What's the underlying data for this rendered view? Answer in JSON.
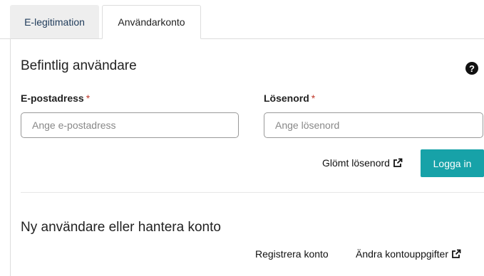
{
  "tabs": [
    {
      "label": "E-legitimation",
      "active": false
    },
    {
      "label": "Användarkonto",
      "active": true
    }
  ],
  "existing_user": {
    "heading": "Befintlig användare",
    "help_icon": "question-circle-icon",
    "email": {
      "label": "E-postadress",
      "required_marker": "*",
      "placeholder": "Ange e-postadress",
      "value": ""
    },
    "password": {
      "label": "Lösenord",
      "required_marker": "*",
      "placeholder": "Ange lösenord",
      "value": ""
    },
    "forgot_password_label": "Glömt lösenord",
    "external_link_icon": "external-link-icon",
    "login_button_label": "Logga in"
  },
  "new_user": {
    "heading": "Ny användare eller hantera konto",
    "register_label": "Registrera konto",
    "change_account_label": "Ändra kontouppgifter"
  },
  "colors": {
    "accent": "#17a2a8",
    "required": "#c0392b",
    "inactive_tab_bg": "#eeeeee",
    "inactive_tab_text": "#1f3b5a"
  }
}
